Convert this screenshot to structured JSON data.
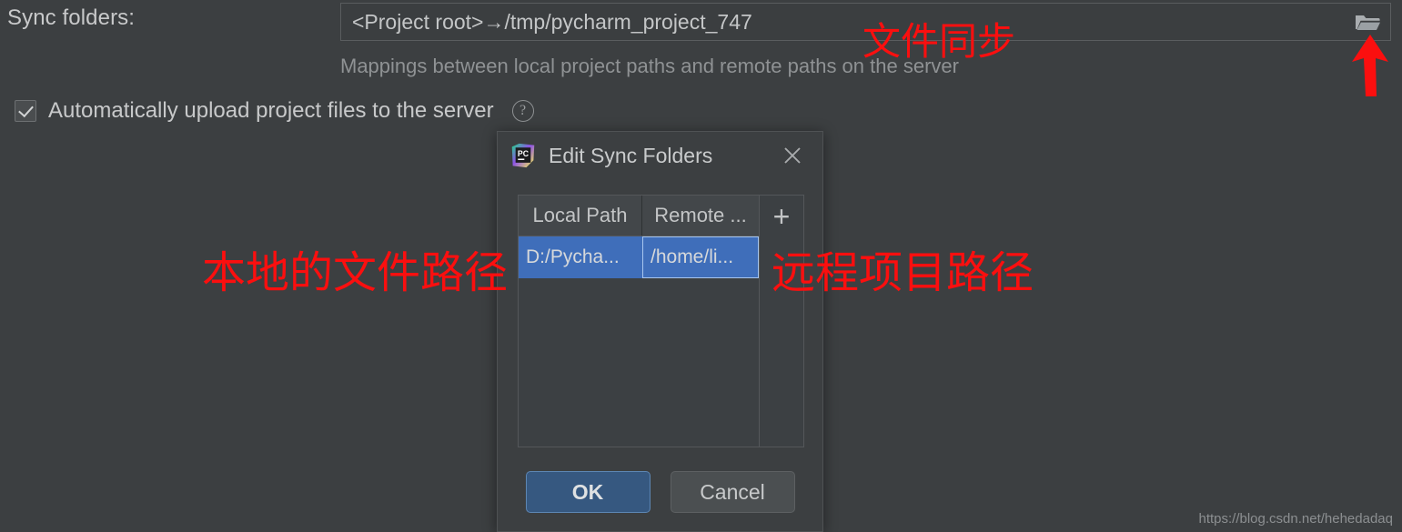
{
  "settings": {
    "sync_folders_label": "Sync folders:",
    "sync_folders_value": "<Project root>→/tmp/pycharm_project_747",
    "sync_folders_hint": "Mappings between local project paths and remote paths on the server",
    "browse_icon": "folder-open-icon",
    "auto_upload_label": "Automatically upload project files to the server",
    "auto_upload_checked": true,
    "help_icon": "question-mark-icon"
  },
  "dialog": {
    "title": "Edit Sync Folders",
    "app_icon": "pycharm-logo-icon",
    "close_icon": "close-x-icon",
    "table": {
      "columns": [
        "Local Path",
        "Remote ..."
      ],
      "rows": [
        {
          "local": "D:/Pycha...",
          "remote": "/home/li..."
        }
      ],
      "add_icon": "plus-icon"
    },
    "buttons": {
      "ok": "OK",
      "cancel": "Cancel"
    }
  },
  "annotations": {
    "sync": "文件同步",
    "local_path": "本地的文件路径",
    "remote_path": "远程项目路径",
    "arrow_icon": "red-up-arrow-icon",
    "color": "#fb0f0f"
  },
  "watermark": "https://blog.csdn.net/hehedadaq"
}
